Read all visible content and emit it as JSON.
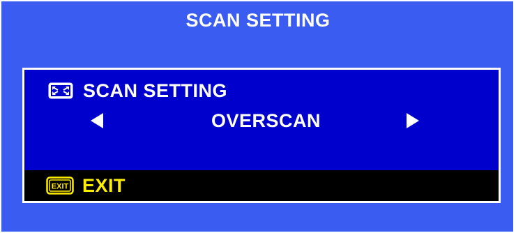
{
  "header": {
    "title": "SCAN SETTING"
  },
  "panel": {
    "setting_icon": "scan-setting-icon",
    "setting_label": "SCAN SETTING",
    "left_icon": "arrow-left-icon",
    "value": "OVERSCAN",
    "right_icon": "arrow-right-icon"
  },
  "footer": {
    "exit_icon": "exit-icon",
    "exit_icon_text": "EXIT",
    "exit_label": "EXIT"
  },
  "colors": {
    "background": "#3a5cf0",
    "panel": "#0000cc",
    "panel_border": "#ffffff",
    "text": "#ffffff",
    "exit_bar": "#000000",
    "exit_text": "#ffee00"
  }
}
